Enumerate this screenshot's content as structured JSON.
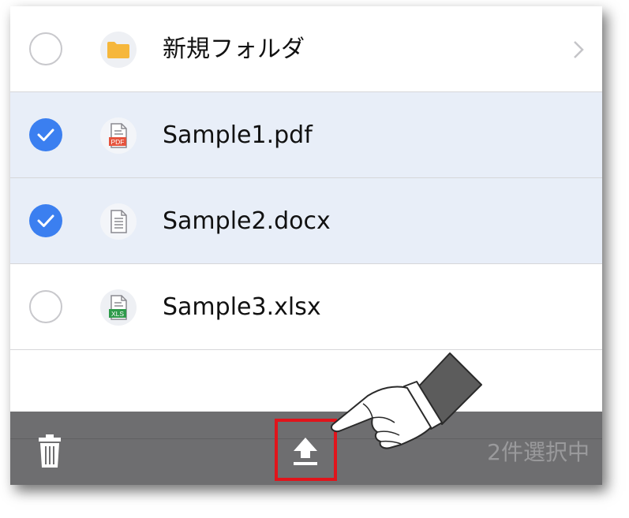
{
  "files": [
    {
      "name": "新規フォルダ",
      "type": "folder",
      "selected": false,
      "has_chevron": true
    },
    {
      "name": "Sample1.pdf",
      "type": "pdf",
      "icon_label": "PDF",
      "selected": true,
      "has_chevron": false
    },
    {
      "name": "Sample2.docx",
      "type": "docx",
      "selected": true,
      "has_chevron": false
    },
    {
      "name": "Sample3.xlsx",
      "type": "xlsx",
      "icon_label": "XLS",
      "selected": false,
      "has_chevron": false
    }
  ],
  "toolbar": {
    "status_text": "2件選択中",
    "delete_icon": "trash-icon",
    "share_icon": "upload-icon"
  },
  "colors": {
    "accent": "#3b7ff0",
    "selected_row": "#e8eef8",
    "toolbar_bg": "#6e6e70",
    "folder": "#f6b73c",
    "pdf": "#e5533d",
    "xls": "#2e9a4a",
    "highlight": "#e1141b"
  }
}
